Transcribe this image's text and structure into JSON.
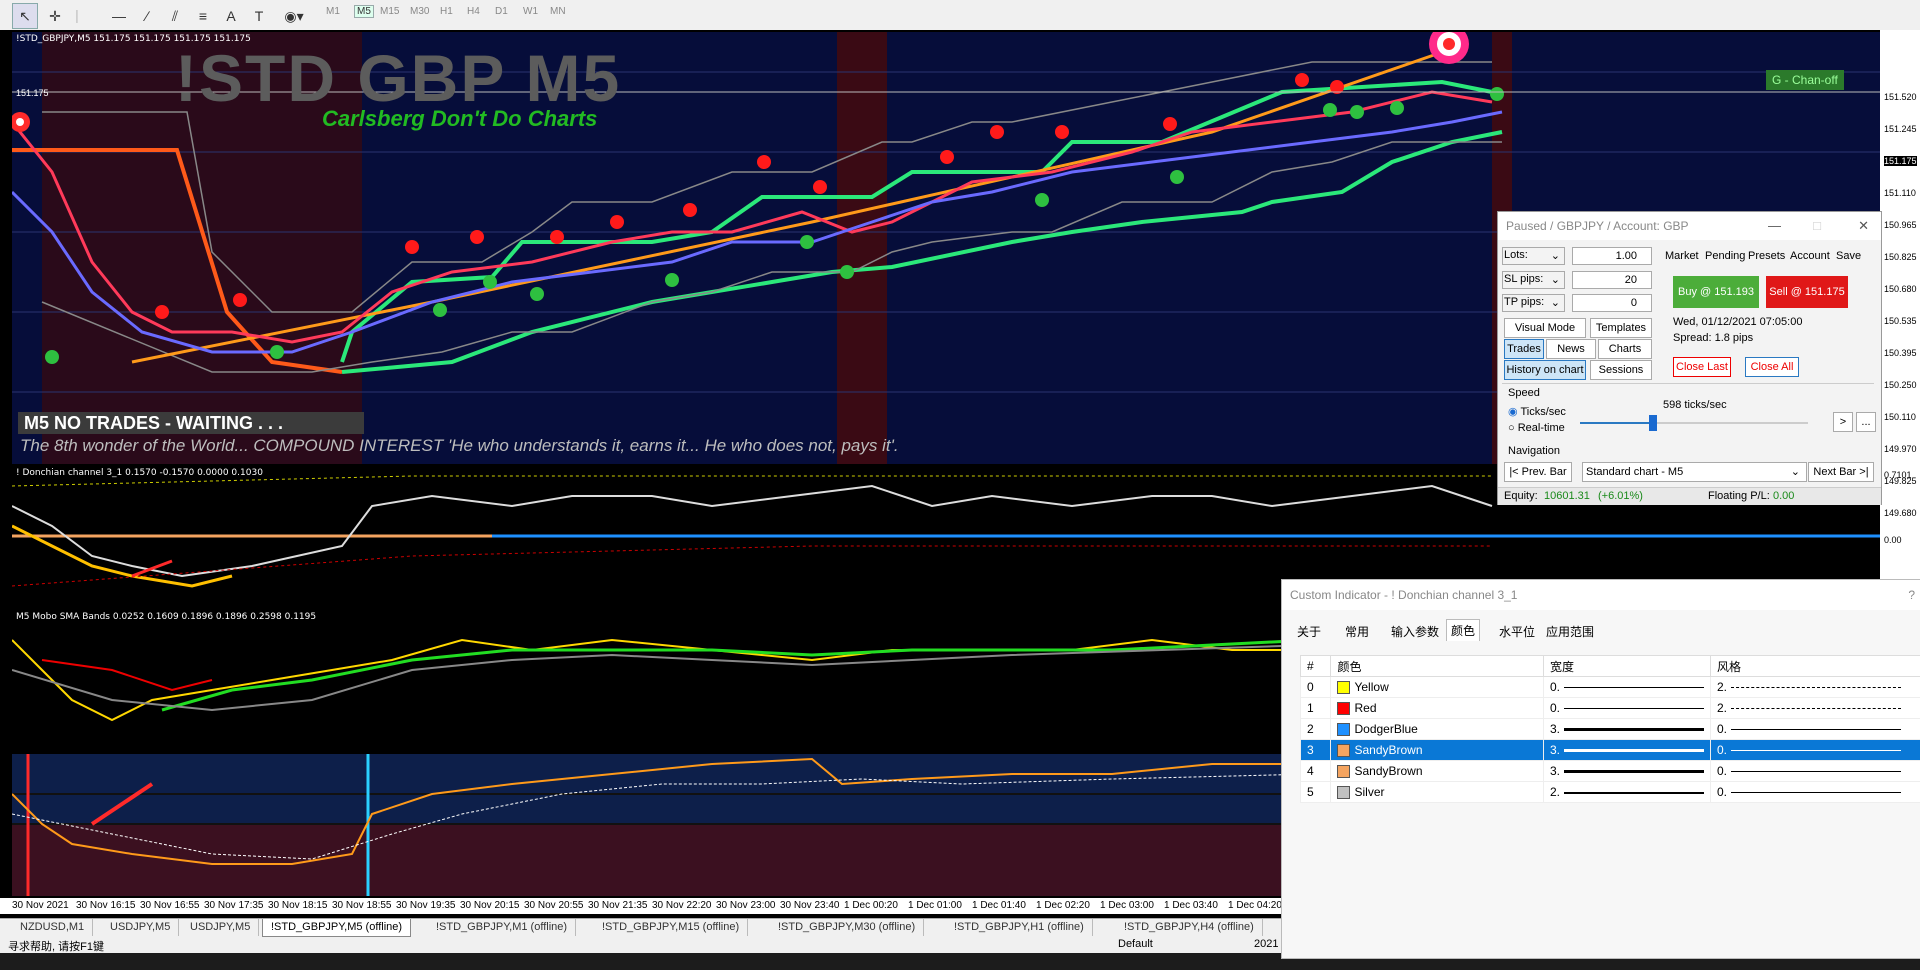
{
  "toolbar": {
    "timeframes": [
      "M1",
      "M5",
      "M15",
      "M30",
      "H1",
      "H4",
      "D1",
      "W1",
      "MN"
    ],
    "selected_timeframe": "M5"
  },
  "chart": {
    "header": "!STD_GBPJPY,M5  151.175 151.175 151.175 151.175",
    "title": "!STD  GBP M5",
    "subtitle": "Carlsberg Don't Do Charts",
    "status_banner": "M5  NO TRADES - WAITING . . .",
    "quote": "The 8th wonder of the World... COMPOUND INTEREST 'He who understands it, earns it... He who does not, pays it'.",
    "chan_off": "G - Chan-off",
    "price_level_label": "151.175",
    "price_labels": [
      "151.520",
      "151.245",
      "151.175",
      "151.110",
      "150.965",
      "150.825",
      "150.680",
      "150.535",
      "150.395",
      "150.250",
      "150.110",
      "149.970",
      "149.825",
      "149.680"
    ],
    "highlight_price": "151.175"
  },
  "panes": {
    "donchian_title": "! Donchian channel 3_1 0.1570 -0.1570 0.0000 0.1030",
    "donchian_scale": [
      "0.7101",
      "0.00"
    ],
    "mobo_title": "M5 Mobo SMA Bands 0.0252 0.1609 0.1896 0.1896 0.2598 0.1195"
  },
  "time_labels": [
    "30 Nov 2021",
    "30 Nov 16:15",
    "30 Nov 16:55",
    "30 Nov 17:35",
    "30 Nov 18:15",
    "30 Nov 18:55",
    "30 Nov 19:35",
    "30 Nov 20:15",
    "30 Nov 20:55",
    "30 Nov 21:35",
    "30 Nov 22:20",
    "30 Nov 23:00",
    "30 Nov 23:40",
    "1 Dec 00:20",
    "1 Dec 01:00",
    "1 Dec 01:40",
    "1 Dec 02:20",
    "1 Dec 03:00",
    "1 Dec 03:40",
    "1 Dec 04:20"
  ],
  "tabs": [
    "NZDUSD,M1",
    "USDJPY,M5",
    "USDJPY,M5",
    "!STD_GBPJPY,M5 (offline)",
    "!STD_GBPJPY,M1 (offline)",
    "!STD_GBPJPY,M15 (offline)",
    "!STD_GBPJPY,M30 (offline)",
    "!STD_GBPJPY,H1 (offline)",
    "!STD_GBPJPY,H4 (offline)"
  ],
  "active_tab": "!STD_GBPJPY,M5 (offline)",
  "status": {
    "help": "寻求帮助, 请按F1键",
    "profile": "Default",
    "year": "2021"
  },
  "trade_panel": {
    "title": "Paused / GBPJPY / Account: GBP",
    "lots_label": "Lots:",
    "lots_value": "1.00",
    "sl_label": "SL pips:",
    "sl_value": "20",
    "tp_label": "TP pips:",
    "tp_value": "0",
    "tabs": [
      "Market",
      "Pending",
      "Presets",
      "Account",
      "Save"
    ],
    "buy": "Buy @ 151.193",
    "sell": "Sell @ 151.175",
    "datetime": "Wed, 01/12/2021  07:05:00",
    "spread": "Spread:  1.8 pips",
    "buttons": {
      "visual_mode": "Visual Mode",
      "templates": "Templates",
      "trades": "Trades",
      "news": "News",
      "charts": "Charts",
      "history": "History on chart",
      "sessions": "Sessions",
      "close_last": "Close Last",
      "close_all": "Close All"
    },
    "speed_label": "Speed",
    "ticks_per_sec": "Ticks/sec",
    "realtime": "Real-time",
    "ticks_value": "598 ticks/sec",
    "speed_level": 0.32,
    "next_arrow": ">",
    "more": "...",
    "navigation_label": "Navigation",
    "prev_bar": "|< Prev. Bar",
    "chart_select": "Standard chart - M5",
    "next_bar": "Next Bar >|",
    "equity_label": "Equity:",
    "equity_value": "10601.31",
    "equity_pct": "(+6.01%)",
    "floating_label": "Floating P/L:",
    "floating_value": "0.00"
  },
  "indicator_dialog": {
    "title": "Custom Indicator - ! Donchian channel 3_1",
    "help": "?",
    "tabs": [
      "关于",
      "常用",
      "输入参数",
      "颜色",
      "水平位",
      "应用范围"
    ],
    "selected_tab": "颜色",
    "columns": [
      "#",
      "颜色",
      "宽度",
      "风格"
    ],
    "rows": [
      {
        "idx": "0",
        "color_name": "Yellow",
        "color": "#ffff00",
        "width": "0.",
        "style": "2."
      },
      {
        "idx": "1",
        "color_name": "Red",
        "color": "#ff0000",
        "width": "0.",
        "style": "2."
      },
      {
        "idx": "2",
        "color_name": "DodgerBlue",
        "color": "#1e90ff",
        "width": "3.",
        "style": "0."
      },
      {
        "idx": "3",
        "color_name": "SandyBrown",
        "color": "#f4a460",
        "width": "3.",
        "style": "0."
      },
      {
        "idx": "4",
        "color_name": "SandyBrown",
        "color": "#f4a460",
        "width": "3.",
        "style": "0."
      },
      {
        "idx": "5",
        "color_name": "Silver",
        "color": "#c0c0c0",
        "width": "2.",
        "style": "0."
      }
    ],
    "selected_row": "3"
  }
}
